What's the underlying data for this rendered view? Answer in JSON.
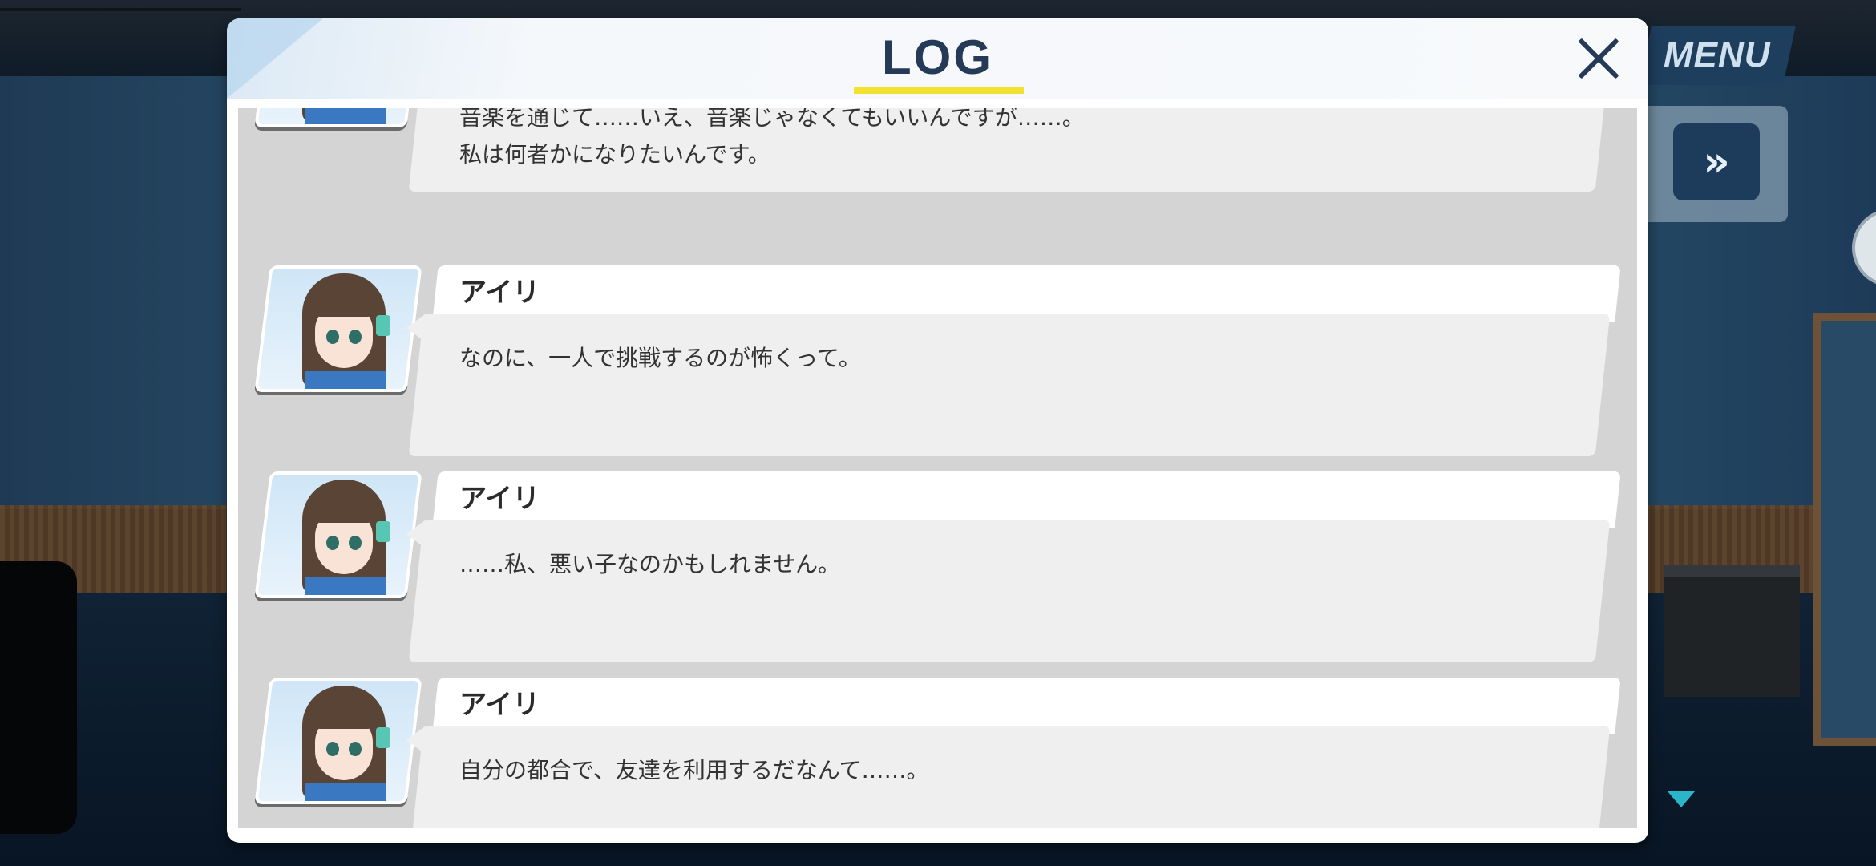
{
  "header": {
    "title": "LOG"
  },
  "side": {
    "menu_label": "MENU",
    "fast_forward_glyph": "»"
  },
  "icons": {
    "close": "close-icon",
    "fast_forward": "fast-forward-icon",
    "scroll_down": "triangle-down-icon"
  },
  "colors": {
    "title_text": "#253a57",
    "title_underline": "#f2e12e",
    "scroll_indicator": "#2bb5c9",
    "menu_button": "#1e3e5e"
  },
  "log": {
    "entries": [
      {
        "speaker": "",
        "lines": [
          "音楽を通じて……いえ、音楽じゃなくてもいいんですが……。",
          "私は何者かになりたいんです。"
        ]
      },
      {
        "speaker": "アイリ",
        "lines": [
          "なのに、一人で挑戦するのが怖くって。"
        ]
      },
      {
        "speaker": "アイリ",
        "lines": [
          "……私、悪い子なのかもしれません。"
        ]
      },
      {
        "speaker": "アイリ",
        "lines": [
          "自分の都合で、友達を利用するだなんて……。"
        ]
      }
    ]
  }
}
